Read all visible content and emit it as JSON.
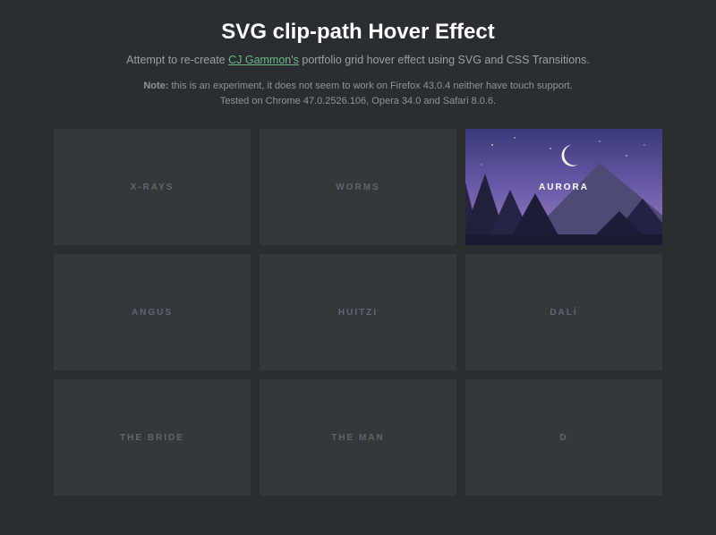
{
  "header": {
    "title": "SVG clip-path Hover Effect",
    "subtitle_before": "Attempt to re-create ",
    "subtitle_link": "CJ Gammon's",
    "subtitle_after": " portfolio grid hover effect using SVG and CSS Transitions.",
    "note_label": "Note:",
    "note_line1": " this is an experiment, it does not seem to work on Firefox 43.0.4 neither have touch support.",
    "note_line2": "Tested on Chrome 47.0.2526.106, Opera 34.0 and Safari 8.0.6."
  },
  "grid": {
    "items": [
      {
        "label": "X-RAYS",
        "hovered": false
      },
      {
        "label": "WORMS",
        "hovered": false
      },
      {
        "label": "AURORA",
        "hovered": true
      },
      {
        "label": "ANGUS",
        "hovered": false
      },
      {
        "label": "HUITZI",
        "hovered": false
      },
      {
        "label": "DALÍ",
        "hovered": false
      },
      {
        "label": "THE BRIDE",
        "hovered": false
      },
      {
        "label": "THE MAN",
        "hovered": false
      },
      {
        "label": "D",
        "hovered": false
      }
    ]
  },
  "colors": {
    "bg": "#2a2e33",
    "card": "#33383d",
    "accent_link": "#6fb77f",
    "aurora_top": "#4a3f8f",
    "aurora_mid": "#7a65b8",
    "aurora_bottom": "#9d7fc7",
    "mountain_dark": "#2b2a47",
    "mountain_light": "#4e4a78",
    "moon": "#f6f3e8"
  }
}
